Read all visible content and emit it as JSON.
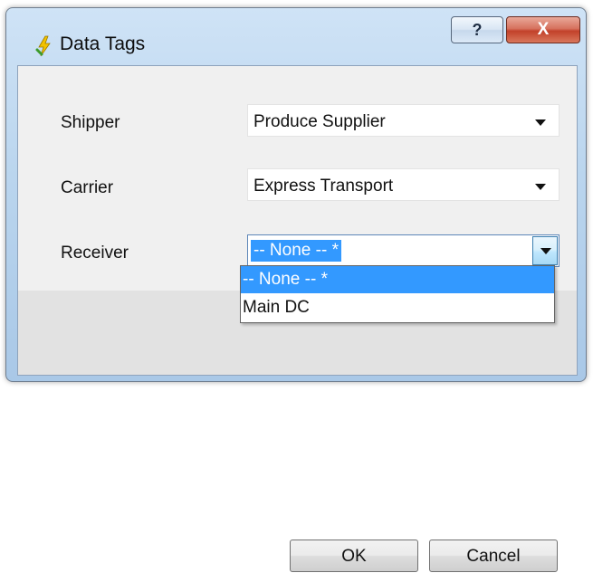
{
  "window": {
    "title": "Data Tags",
    "help_glyph": "?",
    "close_glyph": "X",
    "icon": "lightning-tag-icon"
  },
  "form": {
    "shipper": {
      "label": "Shipper",
      "value": "Produce Supplier"
    },
    "carrier": {
      "label": "Carrier",
      "value": "Express Transport"
    },
    "receiver": {
      "label": "Receiver",
      "value": "-- None -- *"
    }
  },
  "dropdown": {
    "options": [
      "-- None -- *",
      "Main DC"
    ],
    "selected_index": 0
  },
  "buttons": {
    "ok": "OK",
    "cancel": "Cancel"
  },
  "colors": {
    "selection": "#3399ff",
    "close_button": "#c2412a"
  }
}
